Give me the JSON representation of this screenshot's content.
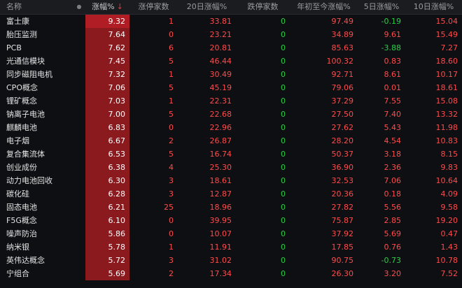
{
  "header": {
    "name": "名称",
    "pct": "涨幅%",
    "sort_indicator": "↓",
    "limit_up": "涨停家数",
    "chg20": "20日涨幅%",
    "limit_down": "跌停家数",
    "ytd": "年初至今涨幅%",
    "chg5": "5日涨幅%",
    "chg10": "10日涨幅%"
  },
  "rows": [
    {
      "name": "富士康",
      "pct": "9.32",
      "limit_up": "1",
      "chg20": "33.81",
      "limit_down": "0",
      "ytd": "97.49",
      "chg5": "-0.19",
      "chg10": "15.04"
    },
    {
      "name": "胎压监测",
      "pct": "7.64",
      "limit_up": "0",
      "chg20": "23.21",
      "limit_down": "0",
      "ytd": "34.89",
      "chg5": "9.61",
      "chg10": "15.49"
    },
    {
      "name": "PCB",
      "pct": "7.62",
      "limit_up": "6",
      "chg20": "20.81",
      "limit_down": "0",
      "ytd": "85.63",
      "chg5": "-3.88",
      "chg10": "7.27"
    },
    {
      "name": "光通信模块",
      "pct": "7.45",
      "limit_up": "5",
      "chg20": "46.44",
      "limit_down": "0",
      "ytd": "100.32",
      "chg5": "0.83",
      "chg10": "18.60"
    },
    {
      "name": "同步磁阻电机",
      "pct": "7.32",
      "limit_up": "1",
      "chg20": "30.49",
      "limit_down": "0",
      "ytd": "92.71",
      "chg5": "8.61",
      "chg10": "10.17"
    },
    {
      "name": "CPO概念",
      "pct": "7.06",
      "limit_up": "5",
      "chg20": "45.19",
      "limit_down": "0",
      "ytd": "79.06",
      "chg5": "0.01",
      "chg10": "18.61"
    },
    {
      "name": "锂矿概念",
      "pct": "7.03",
      "limit_up": "1",
      "chg20": "22.31",
      "limit_down": "0",
      "ytd": "37.29",
      "chg5": "7.55",
      "chg10": "15.08"
    },
    {
      "name": "钠离子电池",
      "pct": "7.00",
      "limit_up": "5",
      "chg20": "22.68",
      "limit_down": "0",
      "ytd": "27.50",
      "chg5": "7.40",
      "chg10": "13.32"
    },
    {
      "name": "麒麟电池",
      "pct": "6.83",
      "limit_up": "0",
      "chg20": "22.96",
      "limit_down": "0",
      "ytd": "27.62",
      "chg5": "5.43",
      "chg10": "11.98"
    },
    {
      "name": "电子烟",
      "pct": "6.67",
      "limit_up": "2",
      "chg20": "26.87",
      "limit_down": "0",
      "ytd": "28.20",
      "chg5": "4.54",
      "chg10": "10.83"
    },
    {
      "name": "复合集流体",
      "pct": "6.53",
      "limit_up": "5",
      "chg20": "16.74",
      "limit_down": "0",
      "ytd": "50.37",
      "chg5": "3.18",
      "chg10": "8.15"
    },
    {
      "name": "创业成份",
      "pct": "6.38",
      "limit_up": "4",
      "chg20": "25.30",
      "limit_down": "0",
      "ytd": "36.90",
      "chg5": "2.36",
      "chg10": "9.83"
    },
    {
      "name": "动力电池回收",
      "pct": "6.30",
      "limit_up": "3",
      "chg20": "18.61",
      "limit_down": "0",
      "ytd": "32.53",
      "chg5": "7.06",
      "chg10": "10.64"
    },
    {
      "name": "碳化硅",
      "pct": "6.28",
      "limit_up": "3",
      "chg20": "12.87",
      "limit_down": "0",
      "ytd": "20.36",
      "chg5": "0.18",
      "chg10": "4.09"
    },
    {
      "name": "固态电池",
      "pct": "6.21",
      "limit_up": "25",
      "chg20": "18.96",
      "limit_down": "0",
      "ytd": "27.82",
      "chg5": "5.56",
      "chg10": "9.58"
    },
    {
      "name": "F5G概念",
      "pct": "6.10",
      "limit_up": "0",
      "chg20": "39.95",
      "limit_down": "0",
      "ytd": "75.87",
      "chg5": "2.85",
      "chg10": "19.20"
    },
    {
      "name": "噪声防治",
      "pct": "5.86",
      "limit_up": "0",
      "chg20": "10.07",
      "limit_down": "0",
      "ytd": "37.92",
      "chg5": "5.69",
      "chg10": "0.47"
    },
    {
      "name": "纳米银",
      "pct": "5.78",
      "limit_up": "1",
      "chg20": "11.91",
      "limit_down": "0",
      "ytd": "17.85",
      "chg5": "0.76",
      "chg10": "1.43"
    },
    {
      "name": "英伟达概念",
      "pct": "5.72",
      "limit_up": "3",
      "chg20": "31.02",
      "limit_down": "0",
      "ytd": "90.75",
      "chg5": "-0.73",
      "chg10": "10.78"
    },
    {
      "name": "宁组合",
      "pct": "5.69",
      "limit_up": "2",
      "chg20": "17.34",
      "limit_down": "0",
      "ytd": "26.30",
      "chg5": "3.20",
      "chg10": "7.52"
    }
  ],
  "colors": {
    "up": "#ff4b4b",
    "down": "#27d043",
    "pct_cell_bg": "#8b1a1f",
    "background": "#0e0f12"
  }
}
